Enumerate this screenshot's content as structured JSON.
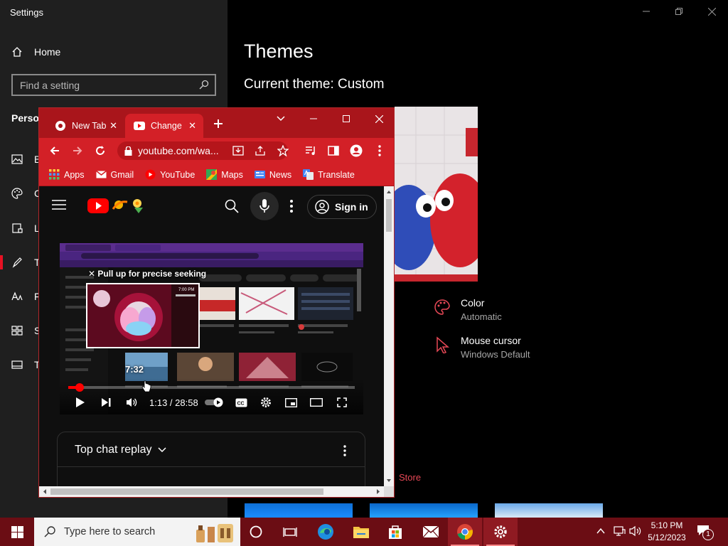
{
  "settings": {
    "window_title": "Settings",
    "home_label": "Home",
    "search_placeholder": "Find a setting",
    "section_label": "Person",
    "nav_letters": [
      "B",
      "C",
      "L",
      "T",
      "F",
      "S",
      "T"
    ],
    "page_title": "Themes",
    "current_theme": "Current theme: Custom",
    "color": {
      "title": "Color",
      "value": "Automatic"
    },
    "cursor": {
      "title": "Mouse cursor",
      "value": "Windows Default"
    },
    "store_link": "Store",
    "accent_color": "#e81123"
  },
  "browser": {
    "tabs": [
      {
        "label": "New Tab"
      },
      {
        "label": "Change"
      }
    ],
    "url": "youtube.com/wa...",
    "bookmarks": [
      {
        "label": "Apps",
        "icon": "apps-grid-icon"
      },
      {
        "label": "Gmail",
        "icon": "gmail-icon"
      },
      {
        "label": "YouTube",
        "icon": "youtube-icon"
      },
      {
        "label": "Maps",
        "icon": "maps-icon"
      },
      {
        "label": "News",
        "icon": "news-icon"
      },
      {
        "label": "Translate",
        "icon": "translate-icon"
      }
    ],
    "theme_color": "#d32027"
  },
  "youtube": {
    "signin_label": "Sign in",
    "seek_hint": "Pull up for precise seeking",
    "preview_time": "7:32",
    "time_display": "1:13 / 28:58",
    "progress": 0.04,
    "chat_title": "Top chat replay"
  },
  "taskbar": {
    "search_placeholder": "Type here to search",
    "time": "5:10 PM",
    "date": "5/12/2023",
    "notification_count": "1"
  }
}
